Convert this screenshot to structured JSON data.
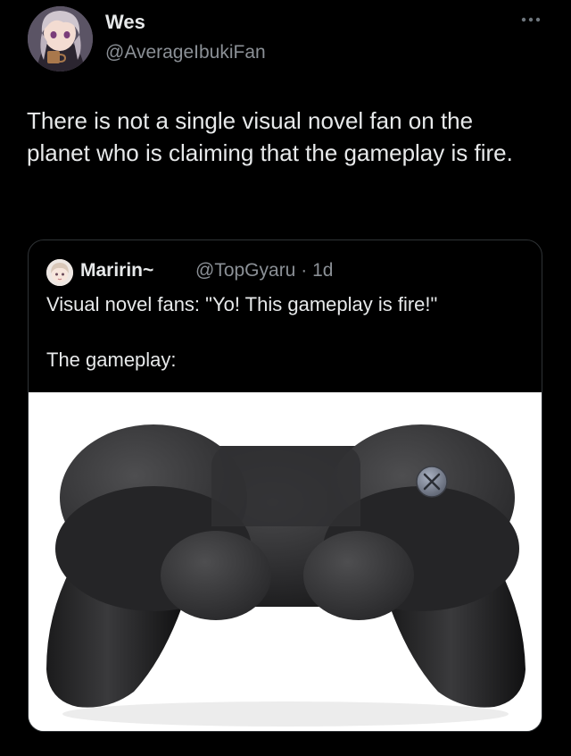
{
  "tweet": {
    "author": {
      "display_name": "Wes",
      "handle": "@AverageIbukiFan",
      "avatar_icon": "anime-avatar"
    },
    "more_icon": "ellipsis-icon",
    "text": "There is not a single visual novel fan on the planet who is claiming that the gameplay is fire."
  },
  "quote": {
    "author": {
      "display_name": "Maririn~",
      "handle": "@TopGyaru",
      "separator": "·",
      "time": "1d",
      "avatar_icon": "anime-avatar"
    },
    "text_line1": "Visual novel fans: \"Yo! This gameplay is fire!\"",
    "text_line2": "The gameplay:",
    "media": {
      "description_icon": "one-button-gamepad-image",
      "button_symbol": "✕"
    }
  },
  "colors": {
    "background": "#000000",
    "primary_text": "#e7e9ea",
    "secondary_text": "#8b9096",
    "border": "#2f3336"
  }
}
